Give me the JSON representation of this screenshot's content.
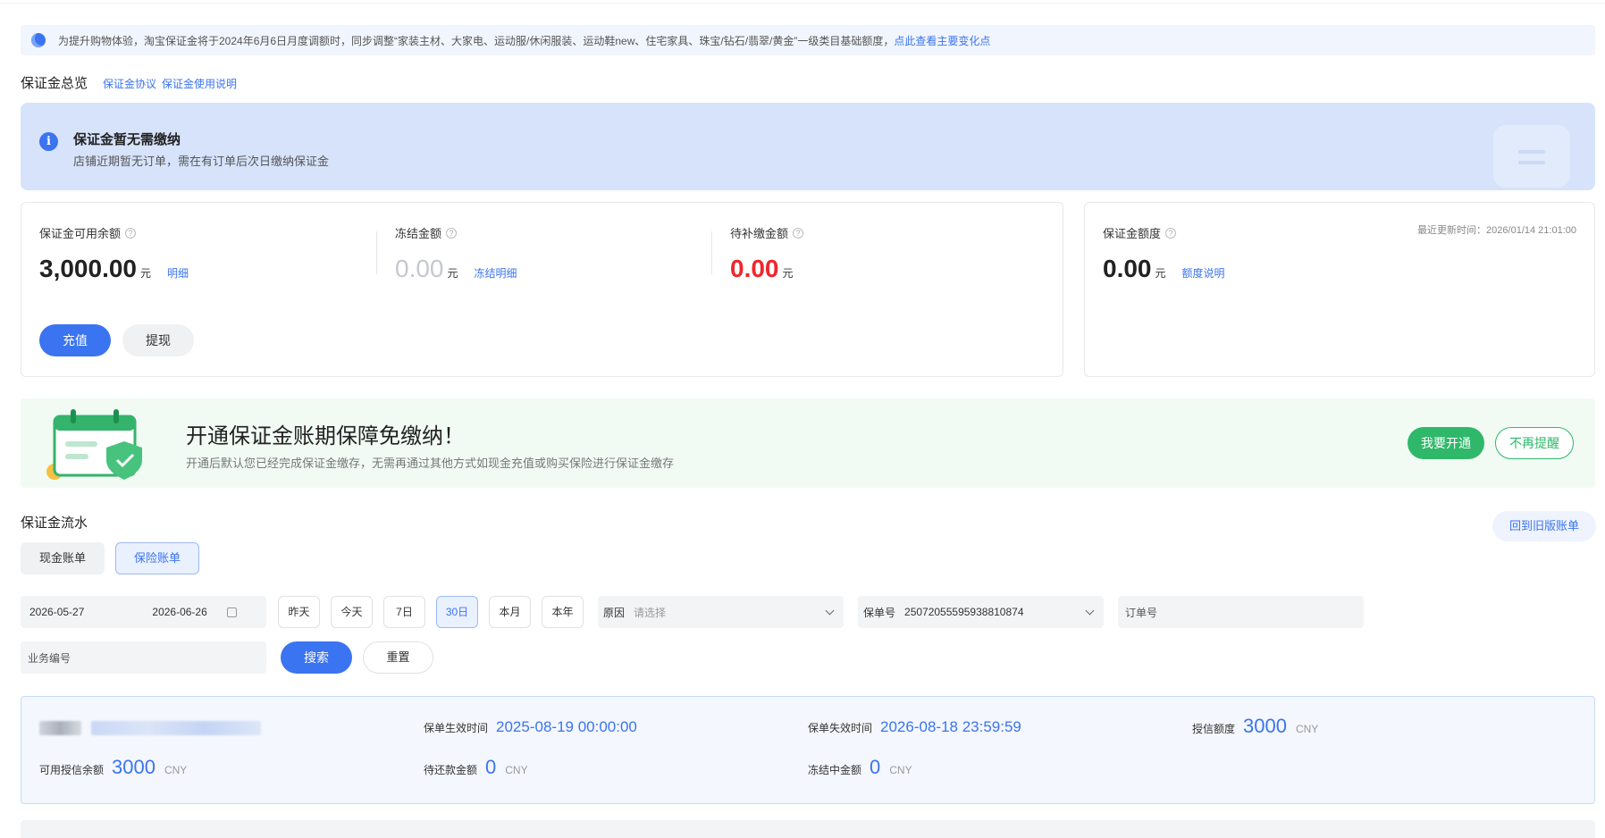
{
  "notice": {
    "text": "为提升购物体验，淘宝保证金将于2024年6月6日月度调额时，同步调整“家装主材、大家电、运动服/休闲服装、运动鞋new、住宅家具、珠宝/钻石/翡翠/黄金”一级类目基础额度，",
    "link": "点此查看主要变化点"
  },
  "overview": {
    "title": "保证金总览",
    "links": [
      "保证金协议",
      "保证金使用说明"
    ]
  },
  "banner": {
    "title": "保证金暂无需缴纳",
    "subtitle": "店铺近期暂无订单，需在有订单后次日缴纳保证金"
  },
  "balance": {
    "available": {
      "label": "保证金可用余额",
      "value": "3,000.00",
      "unit": "元",
      "link": "明细"
    },
    "frozen": {
      "label": "冻结金额",
      "value": "0.00",
      "unit": "元",
      "link": "冻结明细"
    },
    "pending": {
      "label": "待补缴金额",
      "value": "0.00",
      "unit": "元"
    },
    "buttons": {
      "recharge": "充值",
      "withdraw": "提现"
    }
  },
  "quota": {
    "label": "保证金额度",
    "value": "0.00",
    "unit": "元",
    "link": "额度说明",
    "updated": "最近更新时间：2026/01/14 21:01:00"
  },
  "promo": {
    "title": "开通保证金账期保障免缴纳！",
    "subtitle": "开通后默认您已经完成保证金缴存，无需再通过其他方式如现金充值或购买保险进行保证金缴存",
    "open": "我要开通",
    "dismiss": "不再提醒"
  },
  "flow": {
    "title": "保证金流水",
    "tabs": [
      "现金账单",
      "保险账单"
    ],
    "old_bill": "回到旧版账单"
  },
  "filters": {
    "date_start": "2026-05-27",
    "date_end": "2026-06-26",
    "quick": [
      "昨天",
      "今天",
      "7日",
      "30日",
      "本月",
      "本年"
    ],
    "reason_label": "原因",
    "reason_placeholder": "请选择",
    "policy_label": "保单号",
    "policy_value": "25072055595938810874",
    "order_placeholder": "订单号",
    "biz_placeholder": "业务编号",
    "search": "搜索",
    "reset": "重置"
  },
  "insurance": {
    "effective_label": "保单生效时间",
    "effective_value": "2025-08-19 00:00:00",
    "expire_label": "保单失效时间",
    "expire_value": "2026-08-18 23:59:59",
    "credit_label": "授信额度",
    "credit_value": "3000",
    "available_label": "可用授信余额",
    "available_value": "3000",
    "repay_label": "待还款金额",
    "repay_value": "0",
    "frozen_label": "冻结中金额",
    "frozen_value": "0",
    "unit": "CNY"
  },
  "colors": {
    "accent": "#3b74f0",
    "danger": "#f0262b",
    "green": "#2fb86a"
  }
}
